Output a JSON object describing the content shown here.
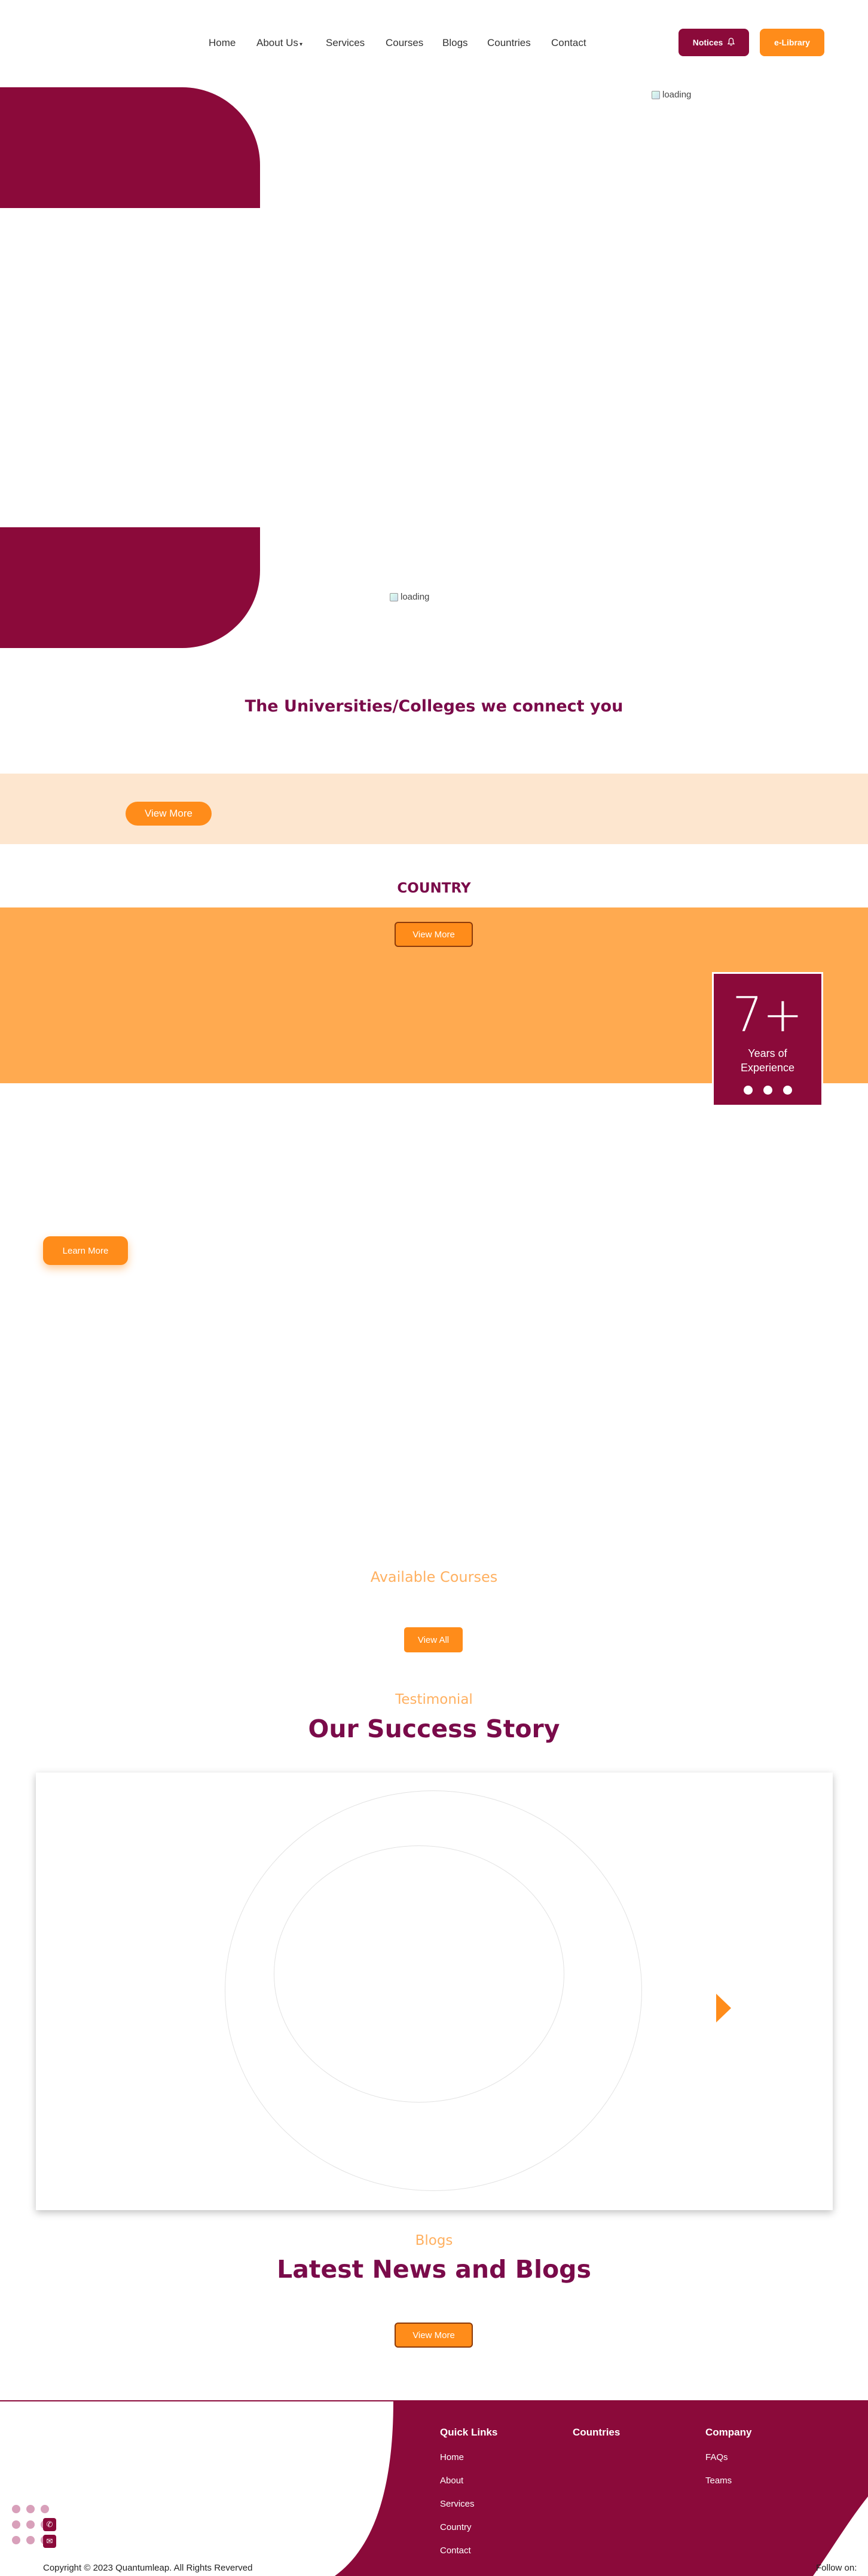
{
  "nav": {
    "home": "Home",
    "about": "About Us",
    "services": "Services",
    "courses": "Courses",
    "blogs": "Blogs",
    "countries": "Countries",
    "contact": "Contact",
    "notices": "Notices",
    "elibrary": "e-Library"
  },
  "hero": {
    "img_alt_1": "loading",
    "img_alt_2": "loading"
  },
  "universities": {
    "title": "The Universities/Colleges we connect you",
    "view_more": "View More"
  },
  "country": {
    "title": "COUNTRY",
    "view_more": "View More"
  },
  "experience": {
    "number": "7+",
    "label_line1": "Years of",
    "label_line2": "Experience",
    "learn_more": "Learn More"
  },
  "courses": {
    "subtitle": "Available Courses",
    "view_all": "View All"
  },
  "testimonial": {
    "subtitle": "Testimonial",
    "title": "Our Success Story"
  },
  "blogs": {
    "subtitle": "Blogs",
    "title": "Latest News and Blogs",
    "view_more": "View More"
  },
  "footer": {
    "quick_links_heading": "Quick Links",
    "countries_heading": "Countries",
    "company_heading": "Company",
    "quick_links": [
      "Home",
      "About",
      "Services",
      "Country",
      "Contact"
    ],
    "company_links": [
      "FAQs",
      "Teams"
    ],
    "copyright": "Copyright © 2023 Quantumleap. All Rights Reverved",
    "follow": "Follow on:"
  },
  "colors": {
    "primary": "#8b0a3a",
    "accent": "#ff8c1a",
    "peach": "#fde6cf",
    "orange_band": "#ffaa50"
  },
  "icons": {
    "notices": "bell-icon",
    "about_dropdown": "caret-down-icon",
    "carousel_next": "arrow-right-icon",
    "phone": "phone-icon",
    "email": "envelope-icon"
  }
}
